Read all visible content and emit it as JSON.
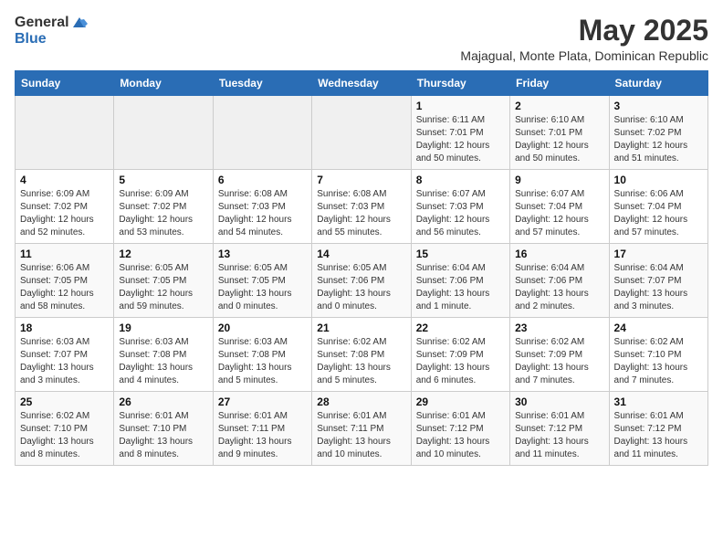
{
  "header": {
    "logo_general": "General",
    "logo_blue": "Blue",
    "month_year": "May 2025",
    "location": "Majagual, Monte Plata, Dominican Republic"
  },
  "weekdays": [
    "Sunday",
    "Monday",
    "Tuesday",
    "Wednesday",
    "Thursday",
    "Friday",
    "Saturday"
  ],
  "weeks": [
    [
      {
        "day": "",
        "info": ""
      },
      {
        "day": "",
        "info": ""
      },
      {
        "day": "",
        "info": ""
      },
      {
        "day": "",
        "info": ""
      },
      {
        "day": "1",
        "info": "Sunrise: 6:11 AM\nSunset: 7:01 PM\nDaylight: 12 hours\nand 50 minutes."
      },
      {
        "day": "2",
        "info": "Sunrise: 6:10 AM\nSunset: 7:01 PM\nDaylight: 12 hours\nand 50 minutes."
      },
      {
        "day": "3",
        "info": "Sunrise: 6:10 AM\nSunset: 7:02 PM\nDaylight: 12 hours\nand 51 minutes."
      }
    ],
    [
      {
        "day": "4",
        "info": "Sunrise: 6:09 AM\nSunset: 7:02 PM\nDaylight: 12 hours\nand 52 minutes."
      },
      {
        "day": "5",
        "info": "Sunrise: 6:09 AM\nSunset: 7:02 PM\nDaylight: 12 hours\nand 53 minutes."
      },
      {
        "day": "6",
        "info": "Sunrise: 6:08 AM\nSunset: 7:03 PM\nDaylight: 12 hours\nand 54 minutes."
      },
      {
        "day": "7",
        "info": "Sunrise: 6:08 AM\nSunset: 7:03 PM\nDaylight: 12 hours\nand 55 minutes."
      },
      {
        "day": "8",
        "info": "Sunrise: 6:07 AM\nSunset: 7:03 PM\nDaylight: 12 hours\nand 56 minutes."
      },
      {
        "day": "9",
        "info": "Sunrise: 6:07 AM\nSunset: 7:04 PM\nDaylight: 12 hours\nand 57 minutes."
      },
      {
        "day": "10",
        "info": "Sunrise: 6:06 AM\nSunset: 7:04 PM\nDaylight: 12 hours\nand 57 minutes."
      }
    ],
    [
      {
        "day": "11",
        "info": "Sunrise: 6:06 AM\nSunset: 7:05 PM\nDaylight: 12 hours\nand 58 minutes."
      },
      {
        "day": "12",
        "info": "Sunrise: 6:05 AM\nSunset: 7:05 PM\nDaylight: 12 hours\nand 59 minutes."
      },
      {
        "day": "13",
        "info": "Sunrise: 6:05 AM\nSunset: 7:05 PM\nDaylight: 13 hours\nand 0 minutes."
      },
      {
        "day": "14",
        "info": "Sunrise: 6:05 AM\nSunset: 7:06 PM\nDaylight: 13 hours\nand 0 minutes."
      },
      {
        "day": "15",
        "info": "Sunrise: 6:04 AM\nSunset: 7:06 PM\nDaylight: 13 hours\nand 1 minute."
      },
      {
        "day": "16",
        "info": "Sunrise: 6:04 AM\nSunset: 7:06 PM\nDaylight: 13 hours\nand 2 minutes."
      },
      {
        "day": "17",
        "info": "Sunrise: 6:04 AM\nSunset: 7:07 PM\nDaylight: 13 hours\nand 3 minutes."
      }
    ],
    [
      {
        "day": "18",
        "info": "Sunrise: 6:03 AM\nSunset: 7:07 PM\nDaylight: 13 hours\nand 3 minutes."
      },
      {
        "day": "19",
        "info": "Sunrise: 6:03 AM\nSunset: 7:08 PM\nDaylight: 13 hours\nand 4 minutes."
      },
      {
        "day": "20",
        "info": "Sunrise: 6:03 AM\nSunset: 7:08 PM\nDaylight: 13 hours\nand 5 minutes."
      },
      {
        "day": "21",
        "info": "Sunrise: 6:02 AM\nSunset: 7:08 PM\nDaylight: 13 hours\nand 5 minutes."
      },
      {
        "day": "22",
        "info": "Sunrise: 6:02 AM\nSunset: 7:09 PM\nDaylight: 13 hours\nand 6 minutes."
      },
      {
        "day": "23",
        "info": "Sunrise: 6:02 AM\nSunset: 7:09 PM\nDaylight: 13 hours\nand 7 minutes."
      },
      {
        "day": "24",
        "info": "Sunrise: 6:02 AM\nSunset: 7:10 PM\nDaylight: 13 hours\nand 7 minutes."
      }
    ],
    [
      {
        "day": "25",
        "info": "Sunrise: 6:02 AM\nSunset: 7:10 PM\nDaylight: 13 hours\nand 8 minutes."
      },
      {
        "day": "26",
        "info": "Sunrise: 6:01 AM\nSunset: 7:10 PM\nDaylight: 13 hours\nand 8 minutes."
      },
      {
        "day": "27",
        "info": "Sunrise: 6:01 AM\nSunset: 7:11 PM\nDaylight: 13 hours\nand 9 minutes."
      },
      {
        "day": "28",
        "info": "Sunrise: 6:01 AM\nSunset: 7:11 PM\nDaylight: 13 hours\nand 10 minutes."
      },
      {
        "day": "29",
        "info": "Sunrise: 6:01 AM\nSunset: 7:12 PM\nDaylight: 13 hours\nand 10 minutes."
      },
      {
        "day": "30",
        "info": "Sunrise: 6:01 AM\nSunset: 7:12 PM\nDaylight: 13 hours\nand 11 minutes."
      },
      {
        "day": "31",
        "info": "Sunrise: 6:01 AM\nSunset: 7:12 PM\nDaylight: 13 hours\nand 11 minutes."
      }
    ]
  ]
}
